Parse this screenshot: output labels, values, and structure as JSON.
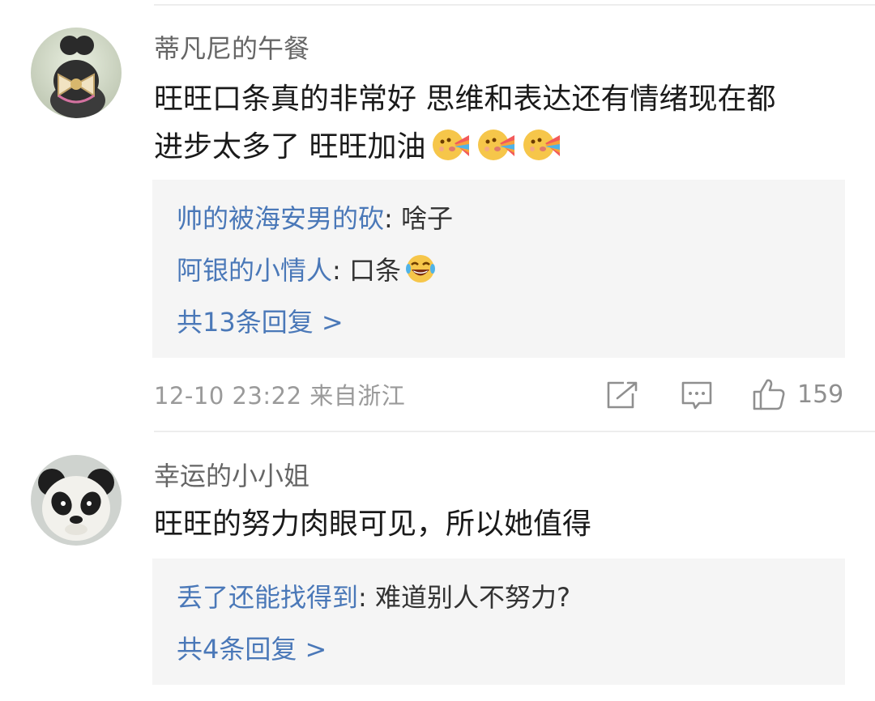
{
  "comments": [
    {
      "username": "蒂凡尼的午餐",
      "text_line1": "旺旺口条真的非常好 思维和表达还有情绪现在都",
      "text_line2": "进步太多了 旺旺加油",
      "emojis": [
        "rainbow-kiss-emoji",
        "rainbow-kiss-emoji",
        "rainbow-kiss-emoji"
      ],
      "replies": [
        {
          "name": "帅的被海安男的砍",
          "sep": ": ",
          "text": "啥子"
        },
        {
          "name": "阿银的小情人",
          "sep": ": ",
          "text": "口条",
          "emoji": "laughing-tears-emoji"
        }
      ],
      "more_replies": "共13条回复 >",
      "timestamp": "12-10 23:22",
      "location": "来自浙江",
      "like_count": "159"
    },
    {
      "username": "幸运的小小姐",
      "text_line1": "旺旺的努力肉眼可见，所以她值得",
      "replies": [
        {
          "name": "丢了还能找得到",
          "sep": ": ",
          "text": "难道别人不努力?"
        }
      ],
      "more_replies": "共4条回复 >"
    }
  ],
  "icons": {
    "share": "share-icon",
    "comment": "comment-icon",
    "like": "thumbs-up-icon"
  },
  "colors": {
    "link_blue": "#4a78b8",
    "reply_bg": "#f5f5f5",
    "meta_gray": "#9a9a9a"
  }
}
